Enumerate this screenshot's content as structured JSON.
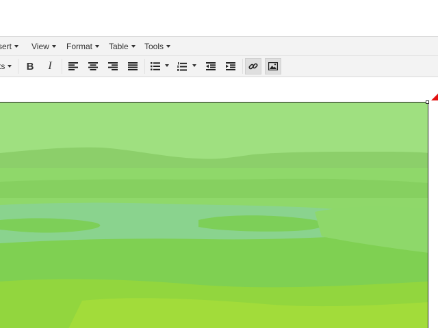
{
  "menubar": {
    "items": [
      {
        "label": "sert",
        "icon": "caret-down-icon"
      },
      {
        "label": "View",
        "icon": "caret-down-icon"
      },
      {
        "label": "Format",
        "icon": "caret-down-icon"
      },
      {
        "label": "Table",
        "icon": "caret-down-icon"
      },
      {
        "label": "Tools",
        "icon": "caret-down-icon"
      }
    ]
  },
  "toolbar": {
    "formats_label": "ts",
    "bold_label": "B",
    "italic_label": "I",
    "buttons": [
      "formats-dropdown",
      "bold-icon",
      "italic-icon",
      "align-left-icon",
      "align-center-icon",
      "align-right-icon",
      "align-justify-icon",
      "bullet-list-icon",
      "numbered-list-icon",
      "outdent-icon",
      "indent-icon",
      "link-icon",
      "image-icon"
    ],
    "active_buttons": [
      "link-icon",
      "image-icon"
    ]
  },
  "editor": {
    "image": {
      "subject": "green wetland landscape with river, grass and distant hills",
      "tint": "#8fe07a",
      "selected": true
    },
    "resize_handle_color": "#e31010"
  }
}
